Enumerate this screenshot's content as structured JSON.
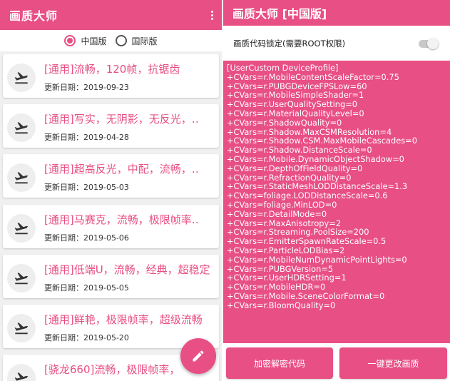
{
  "left": {
    "title": "画质大师",
    "radios": [
      {
        "label": "中国版",
        "selected": true
      },
      {
        "label": "国际版",
        "selected": false
      }
    ],
    "date_prefix": "更新日期：",
    "items": [
      {
        "title": "[通用]流畅，120帧，抗锯齿",
        "date": "2019-09-23"
      },
      {
        "title": "[通用]写实，无阴影，无反光，‥",
        "date": "2019-04-28"
      },
      {
        "title": "[通用]超高反光，中配，流畅，‥",
        "date": "2019-05-03"
      },
      {
        "title": "[通用]马赛克，流畅，极限帧率‥",
        "date": "2019-05-06"
      },
      {
        "title": "[通用]低端U，流畅，经典，超稳定",
        "date": "2019-05-05"
      },
      {
        "title": "[通用]鲜艳，极限帧率，超级流畅",
        "date": "2019-05-20"
      },
      {
        "title": "[骁龙660]流畅，极限帧率，",
        "date": ""
      }
    ]
  },
  "right": {
    "title": "画质大师 [中国版]",
    "lock_label": "画质代码锁定(需要ROOT权限)",
    "lock_on": false,
    "code_lines": [
      "[UserCustom DeviceProfile]",
      "+CVars=r.MobileContentScaleFactor=0.75",
      "+CVars=r.PUBGDeviceFPSLow=60",
      "+CVars=r.MobileSimpleShader=1",
      "+CVars=r.UserQualitySetting=0",
      "+CVars=r.MaterialQualityLevel=0",
      "+CVars=r.ShadowQuality=0",
      "+CVars=r.Shadow.MaxCSMResolution=4",
      "+CVars=r.Shadow.CSM.MaxMobileCascades=0",
      "+CVars=r.Shadow.DistanceScale=0",
      "+CVars=r.Mobile.DynamicObjectShadow=0",
      "+CVars=r.DepthOfFieldQuality=0",
      "+CVars=r.RefractionQuality=0",
      "+CVars=r.StaticMeshLODDistanceScale=1.3",
      "+CVars=foliage.LODDistanceScale=0.6",
      "+CVars=foliage.MinLOD=0",
      "+CVars=r.DetailMode=0",
      "+CVars=r.MaxAnisotropy=2",
      "+CVars=r.Streaming.PoolSize=200",
      "+CVars=r.EmitterSpawnRateScale=0.5",
      "+CVars=r.ParticleLODBias=2",
      "+CVars=r.MobileNumDynamicPointLights=0",
      "+CVars=r.PUBGVersion=5",
      "+CVars=r.UserHDRSetting=1",
      "+CVars=r.MobileHDR=0",
      "+CVars=r.Mobile.SceneColorFormat=0",
      "+CVars=r.BloomQuality=0"
    ],
    "buttons": {
      "encrypt": "加密解密代码",
      "apply": "一键更改画质"
    }
  },
  "colors": {
    "accent": "#e84f84",
    "background": "#f0f0f0"
  },
  "icons": {
    "item_icon": "airplane-takeoff-icon",
    "fab_icon": "pencil-icon",
    "menu_icon": "more-vert-icon"
  }
}
